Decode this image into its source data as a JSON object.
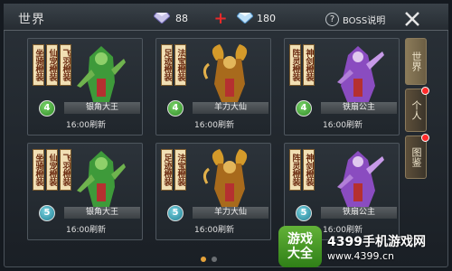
{
  "header": {
    "title": "世界",
    "diamond": "88",
    "bound_diamond": "180",
    "boss_info_label": "BOSS说明"
  },
  "side_tabs": [
    "世界",
    "个人",
    "图鉴"
  ],
  "cards": [
    {
      "tags": [
        "坐骑橙装",
        "仙宠橙装",
        "飞羽橙装"
      ],
      "level": "4",
      "name": "银角大王",
      "refresh": "16:00刷新",
      "art": "green"
    },
    {
      "tags": [
        "足迹橙装",
        "法宝橙装"
      ],
      "level": "4",
      "name": "羊力大仙",
      "refresh": "16:00刷新",
      "art": "gold"
    },
    {
      "tags": [
        "阵灵橙装",
        "神剑橙装"
      ],
      "level": "4",
      "name": "铁扇公主",
      "refresh": "16:00刷新",
      "art": "purple"
    },
    {
      "tags": [
        "坐骑橙装",
        "仙宠橙装",
        "飞羽橙装"
      ],
      "level": "5",
      "name": "银角大王",
      "refresh": "16:00刷新",
      "art": "green"
    },
    {
      "tags": [
        "足迹橙装",
        "法宝橙装"
      ],
      "level": "5",
      "name": "羊力大仙",
      "refresh": "16:00刷新",
      "art": "gold"
    },
    {
      "tags": [
        "阵灵橙装",
        "神剑橙装"
      ],
      "level": "5",
      "name": "铁扇公主",
      "refresh": "16:00刷新",
      "art": "purple"
    }
  ],
  "watermark": {
    "logo_top": "游戏",
    "logo_bottom": "大全",
    "main": "4399手机游戏网",
    "url": "www.4399.cn"
  },
  "colors": {
    "accent": "#e5a23a",
    "level_green": "#2d8a23",
    "level_blue": "#1f7f93",
    "plus_red": "#e82a2a"
  }
}
